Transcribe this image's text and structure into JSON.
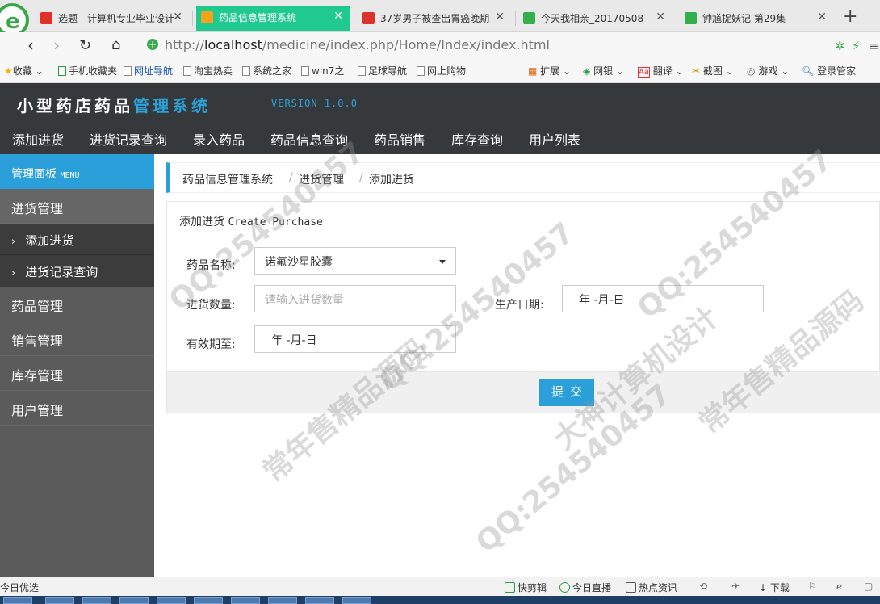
{
  "browser": {
    "tabs": [
      {
        "title": "选题 - 计算机专业毕业设计",
        "fav_color": "#e2312d"
      },
      {
        "title": "药品信息管理系统",
        "fav_color": "#f3a21c"
      },
      {
        "title": "37岁男子被查出胃癌晚期",
        "fav_color": "#d9332b"
      },
      {
        "title": "今天我相亲_20170508",
        "fav_color": "#33b04c"
      },
      {
        "title": "钟馗捉妖记 第29集",
        "fav_color": "#33b04c"
      }
    ],
    "url_prefix": "http://",
    "url_host": "localhost",
    "url_path": "/medicine/index.php/Home/Index/index.html",
    "bookmarks": [
      "收藏",
      "手机收藏夹",
      "网址导航",
      "淘宝热卖",
      "系统之家",
      "win7之",
      "足球导航",
      "网上购物"
    ],
    "extensions": [
      "扩展",
      "网银",
      "翻译",
      "截图",
      "游戏",
      "登录管家"
    ]
  },
  "app": {
    "title_main": "小型药店药品",
    "title_accent": "管理系统",
    "version": "VERSION 1.0.0",
    "nav": [
      "添加进货",
      "进货记录查询",
      "录入药品",
      "药品信息查询",
      "药品销售",
      "库存查询",
      "用户列表"
    ]
  },
  "sidebar": {
    "head_label": "管理面板",
    "head_tag": "MENU",
    "sections": [
      "进货管理",
      "药品管理",
      "销售管理",
      "库存管理",
      "用户管理"
    ],
    "sub_items": [
      "添加进货",
      "进货记录查询"
    ]
  },
  "breadcrumb": [
    "药品信息管理系统",
    "进货管理",
    "添加进货"
  ],
  "form": {
    "title_cn": "添加进货",
    "title_en": "Create Purchase",
    "drug_label": "药品名称:",
    "drug_value": "诺氟沙星胶囊",
    "qty_label": "进货数量:",
    "qty_placeholder": "请输入进货数量",
    "prod_date_label": "生产日期:",
    "prod_date_value": "年 -月-日",
    "expiry_label": "有效期至:",
    "expiry_value": "年 -月-日",
    "submit": "提交"
  },
  "statusbar": {
    "left": "今日优选",
    "items": [
      "快剪辑",
      "今日直播",
      "热点资讯",
      "下载"
    ]
  },
  "watermark": [
    "QQ:254540457",
    "常年售精品源码",
    "大神计算机设计"
  ]
}
